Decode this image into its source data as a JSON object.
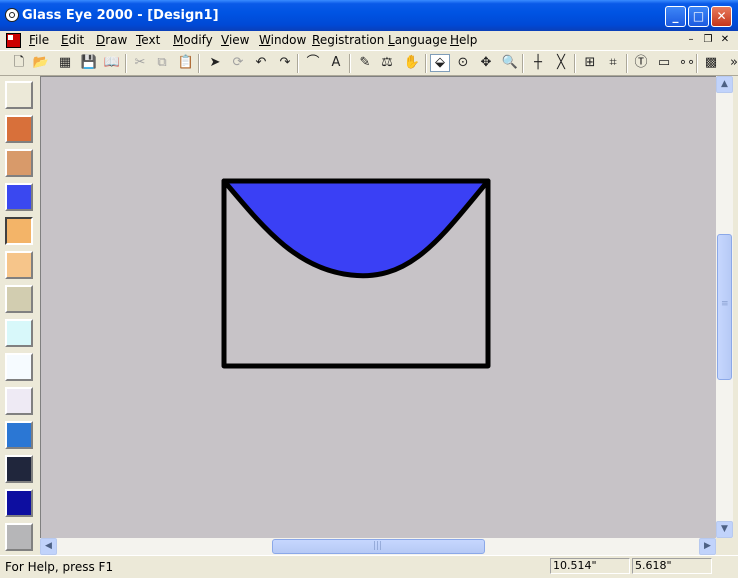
{
  "window": {
    "title": "Glass Eye 2000 - [Design1]",
    "minimize_icon": "minimize-icon",
    "maximize_icon": "maximize-icon",
    "close_icon": "close-icon"
  },
  "menu": {
    "items": [
      "File",
      "Edit",
      "Draw",
      "Text",
      "Modify",
      "View",
      "Window",
      "Registration",
      "Language",
      "Help"
    ]
  },
  "toolbar": {
    "tools": [
      {
        "icon": "new-document-icon",
        "glyph": "🗋",
        "enabled": true
      },
      {
        "icon": "open-folder-icon",
        "glyph": "📂",
        "enabled": true
      },
      {
        "icon": "grid-pattern-icon",
        "glyph": "▦",
        "enabled": true
      },
      {
        "icon": "save-icon",
        "glyph": "💾",
        "enabled": true
      },
      {
        "icon": "print-preview-icon",
        "glyph": "📖",
        "enabled": true
      },
      {
        "icon": "cut-icon",
        "glyph": "✂",
        "enabled": false
      },
      {
        "icon": "copy-icon",
        "glyph": "⧉",
        "enabled": false
      },
      {
        "icon": "paste-icon",
        "glyph": "📋",
        "enabled": true
      },
      {
        "icon": "select-arrow-icon",
        "glyph": "➤",
        "enabled": true
      },
      {
        "icon": "rotate-node-icon",
        "glyph": "⟳",
        "enabled": false
      },
      {
        "icon": "undo-icon",
        "glyph": "↶",
        "enabled": true
      },
      {
        "icon": "redo-icon",
        "glyph": "↷",
        "enabled": true
      },
      {
        "icon": "curve-tool-icon",
        "glyph": "⌒",
        "enabled": true
      },
      {
        "icon": "text-tool-icon",
        "glyph": "A",
        "enabled": true
      },
      {
        "icon": "pencil-icon",
        "glyph": "✎",
        "enabled": true
      },
      {
        "icon": "stamp-icon",
        "glyph": "⚖",
        "enabled": true
      },
      {
        "icon": "hand-pan-icon",
        "glyph": "✋",
        "enabled": true
      },
      {
        "icon": "paint-bucket-icon",
        "glyph": "⬙",
        "enabled": true
      },
      {
        "icon": "target-icon",
        "glyph": "⊙",
        "enabled": true
      },
      {
        "icon": "move-arrows-icon",
        "glyph": "✥",
        "enabled": true
      },
      {
        "icon": "zoom-icon",
        "glyph": "🔍",
        "enabled": true
      },
      {
        "icon": "crosshair-icon",
        "glyph": "┼",
        "enabled": true
      },
      {
        "icon": "diagonal-cross-icon",
        "glyph": "╳",
        "enabled": true
      },
      {
        "icon": "grid-icon",
        "glyph": "⊞",
        "enabled": true
      },
      {
        "icon": "snap-grid-icon",
        "glyph": "⌗",
        "enabled": true
      },
      {
        "icon": "text-cursor-icon",
        "glyph": "Ⓣ",
        "enabled": true
      },
      {
        "icon": "ruler-icon",
        "glyph": "▭",
        "enabled": true
      },
      {
        "icon": "nodes-icon",
        "glyph": "∘∘",
        "enabled": true
      },
      {
        "icon": "pattern-icon",
        "glyph": "▩",
        "enabled": true
      },
      {
        "icon": "overflow-chevron-icon",
        "glyph": "»",
        "enabled": true
      }
    ]
  },
  "palette": {
    "swatches": [
      {
        "name": "blank",
        "color": "#ece9d8"
      },
      {
        "name": "red-orange-streaky",
        "color": "#d8703a"
      },
      {
        "name": "peach-mottled",
        "color": "#d89a6a"
      },
      {
        "name": "blue",
        "color": "#3a48f0"
      },
      {
        "name": "orange-amber",
        "color": "#f3b468"
      },
      {
        "name": "light-orange",
        "color": "#f6c58a"
      },
      {
        "name": "cream-granite",
        "color": "#d2cdb0"
      },
      {
        "name": "pale-aqua",
        "color": "#d8f8fa"
      },
      {
        "name": "white",
        "color": "#f6fbff"
      },
      {
        "name": "pearl-white",
        "color": "#eeeaf4"
      },
      {
        "name": "rippled-blue",
        "color": "#2b77d4"
      },
      {
        "name": "navy-dark",
        "color": "#20263c"
      },
      {
        "name": "cobalt",
        "color": "#0d0ea0"
      },
      {
        "name": "grey",
        "color": "#b6b6b8"
      }
    ],
    "selected_index": 4
  },
  "design": {
    "fill_color": "#3a40f5",
    "outline_color": "#000000",
    "canvas_color": "#c7c3c7"
  },
  "statusbar": {
    "help_text": "For Help, press F1",
    "coord_x": "10.514\"",
    "coord_y": "5.618\""
  }
}
